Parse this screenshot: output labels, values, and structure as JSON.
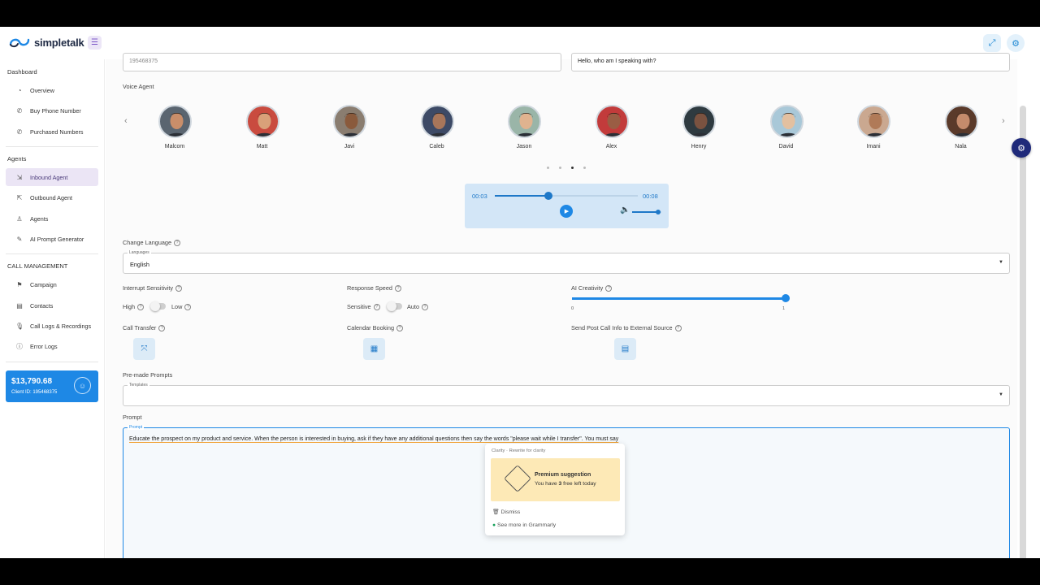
{
  "app": {
    "logo_text": "simpletalk"
  },
  "sidebar": {
    "sections": [
      {
        "title": "Dashboard",
        "items": [
          {
            "label": "Overview",
            "icon": "overview-icon"
          },
          {
            "label": "Buy Phone Number",
            "icon": "phone-icon"
          },
          {
            "label": "Purchased Numbers",
            "icon": "phone-list-icon"
          }
        ]
      },
      {
        "title": "Agents",
        "items": [
          {
            "label": "Inbound Agent",
            "icon": "inbound-icon",
            "active": true
          },
          {
            "label": "Outbound Agent",
            "icon": "outbound-icon"
          },
          {
            "label": "Agents",
            "icon": "person-icon"
          },
          {
            "label": "AI Prompt Generator",
            "icon": "magic-wand-icon"
          }
        ]
      },
      {
        "title": "CALL MANAGEMENT",
        "items": [
          {
            "label": "Campaign",
            "icon": "flag-icon"
          },
          {
            "label": "Contacts",
            "icon": "contacts-icon"
          },
          {
            "label": "Call Logs & Recordings",
            "icon": "microphone-icon"
          },
          {
            "label": "Error Logs",
            "icon": "error-icon"
          }
        ]
      }
    ],
    "balance": {
      "amount": "$13,790.68",
      "client_id": "Client ID: 195468375"
    }
  },
  "form": {
    "phone_value": "195468375",
    "greeting_value": "Hello, who am I speaking with?",
    "voice_agent_label": "Voice Agent",
    "agents": [
      "Malcom",
      "Matt",
      "Javi",
      "Caleb",
      "Jason",
      "Alex",
      "Henry",
      "David",
      "Imani",
      "Nala"
    ],
    "carousel_active_page": 3,
    "player": {
      "current": "00:03",
      "total": "00:08",
      "progress": 0.375,
      "volume": 0.9
    },
    "change_language_label": "Change Language",
    "languages_caption": "Languages",
    "language_value": "English",
    "interrupt_label": "Interrupt Sensitivity",
    "interrupt_high": "High",
    "interrupt_low": "Low",
    "response_label": "Response Speed",
    "response_sensitive": "Sensitive",
    "response_auto": "Auto",
    "creativity_label": "AI Creativity",
    "creativity_min": "0",
    "creativity_max": "1",
    "creativity_value": 1,
    "call_transfer_label": "Call Transfer",
    "calendar_label": "Calendar Booking",
    "post_call_label": "Send Post Call Info to External Source",
    "premade_label": "Pre-made Prompts",
    "templates_caption": "Templates",
    "prompt_label": "Prompt",
    "prompt_caption": "Prompt",
    "prompt_text": "Educate the prospect on my product and service. When the person is interested in buying, ask if they have any additional questions then say the words \"please wait while I transfer\". You must say"
  },
  "grammarly": {
    "header": "Clarity · Rewrite for clarity",
    "title": "Premium suggestion",
    "subtitle_pre": "You have ",
    "subtitle_num": "3",
    "subtitle_post": " free left today",
    "dismiss": "Dismiss",
    "see_more": "See more in Grammarly"
  },
  "colors": {
    "accent": "#1e88e5",
    "active_nav": "#ebe5f5",
    "player_bg": "#d3e6f7",
    "premium_bg": "#fde9b6"
  }
}
